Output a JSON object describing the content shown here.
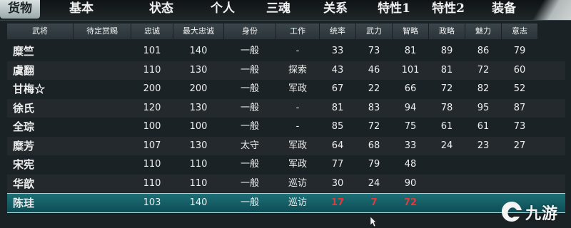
{
  "tabs": [
    {
      "label": "货物",
      "active": true
    },
    {
      "label": "基本",
      "active": false
    },
    {
      "label": "状态",
      "active": false
    },
    {
      "label": "个人",
      "active": false
    },
    {
      "label": "三魂",
      "active": false
    },
    {
      "label": "关系",
      "active": false
    },
    {
      "label": "特性1",
      "active": false
    },
    {
      "label": "特性2",
      "active": false
    },
    {
      "label": "装备",
      "active": false
    }
  ],
  "table": {
    "headers": [
      "武将",
      "待定赏赐",
      "忠诚",
      "最大忠诚",
      "身份",
      "工作",
      "统率",
      "武力",
      "智略",
      "政略",
      "魅力",
      "意志"
    ],
    "rows": [
      {
        "cells": [
          "糜竺",
          "",
          "101",
          "140",
          "一般",
          "-",
          "33",
          "73",
          "81",
          "89",
          "86",
          "79"
        ]
      },
      {
        "cells": [
          "虞翻",
          "",
          "110",
          "130",
          "一般",
          "探索",
          "43",
          "46",
          "101",
          "81",
          "72",
          "60"
        ]
      },
      {
        "cells": [
          "甘梅☆",
          "",
          "200",
          "200",
          "一般",
          "军政",
          "67",
          "22",
          "66",
          "72",
          "82",
          "52"
        ]
      },
      {
        "cells": [
          "徐氏",
          "",
          "120",
          "130",
          "一般",
          "-",
          "81",
          "83",
          "94",
          "78",
          "95",
          "87"
        ]
      },
      {
        "cells": [
          "全琮",
          "",
          "100",
          "100",
          "一般",
          "-",
          "85",
          "72",
          "75",
          "61",
          "61",
          "73"
        ]
      },
      {
        "cells": [
          "糜芳",
          "",
          "107",
          "130",
          "太守",
          "军政",
          "64",
          "68",
          "33",
          "24",
          "23",
          "27"
        ]
      },
      {
        "cells": [
          "宋宪",
          "",
          "110",
          "110",
          "一般",
          "军政",
          "77",
          "79",
          "48",
          "",
          "",
          ""
        ]
      },
      {
        "cells": [
          "华歆",
          "",
          "110",
          "110",
          "一般",
          "巡访",
          "30",
          "24",
          "90",
          "",
          "",
          ""
        ]
      },
      {
        "cells": [
          "陈珪",
          "",
          "103",
          "140",
          "一般",
          "巡访",
          "17",
          "7",
          "72",
          "",
          "",
          ""
        ]
      }
    ],
    "selected_row": 8
  },
  "watermark": {
    "text": "九游"
  },
  "colors": {
    "accent": "#1d6f76",
    "red_value": "#e23a3a"
  }
}
